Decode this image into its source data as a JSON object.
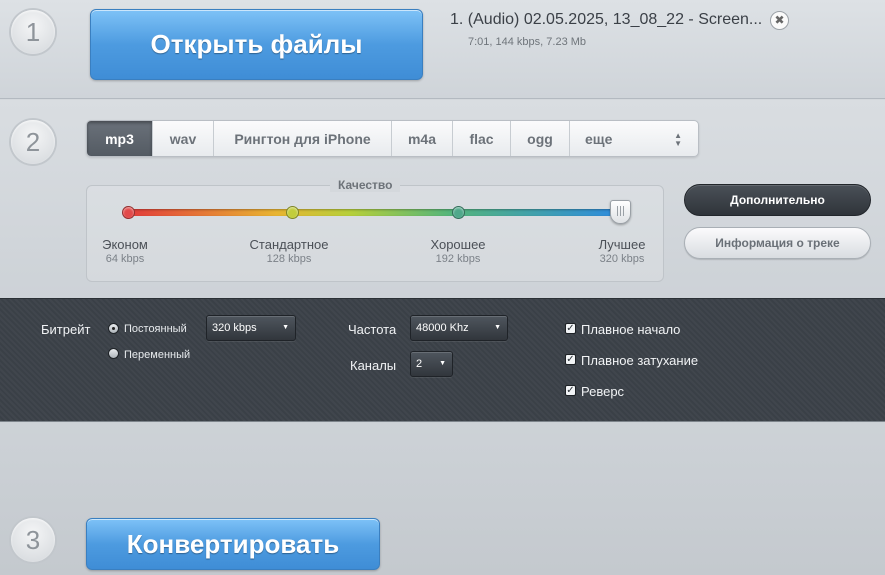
{
  "steps": [
    "1",
    "2",
    "3"
  ],
  "open_files_label": "Открыть файлы",
  "file": {
    "title": "1. (Audio) 02.05.2025, 13_08_22 - Screen...",
    "meta": "7:01, 144 kbps, 7.23 Mb",
    "close_glyph": "✖"
  },
  "formats": [
    "mp3",
    "wav",
    "Рингтон для iPhone",
    "m4a",
    "flac",
    "ogg"
  ],
  "format_more": "еще",
  "format_more_arrows": "▲▼",
  "quality": {
    "title": "Качество",
    "levels": [
      {
        "name": "Эконом",
        "rate": "64 kbps"
      },
      {
        "name": "Стандартное",
        "rate": "128 kbps"
      },
      {
        "name": "Хорошее",
        "rate": "192 kbps"
      },
      {
        "name": "Лучшее",
        "rate": "320 kbps"
      }
    ],
    "selected_index": 3,
    "dot_colors": [
      "#e24a4a",
      "#c2cd3b",
      "#4fa88a"
    ]
  },
  "advanced_button": "Дополнительно",
  "track_info_button": "Информация о треке",
  "advanced": {
    "bitrate_label": "Битрейт",
    "bitrate_modes": [
      {
        "label": "Постоянный",
        "checked": true
      },
      {
        "label": "Переменный",
        "checked": false
      }
    ],
    "bitrate_value": "320 kbps",
    "frequency_label": "Частота",
    "frequency_value": "48000 Khz",
    "channels_label": "Каналы",
    "channels_value": "2",
    "caret": "▼",
    "options": [
      {
        "label": "Плавное начало",
        "checked": true
      },
      {
        "label": "Плавное затухание",
        "checked": true
      },
      {
        "label": "Реверс",
        "checked": true
      }
    ],
    "check_glyph": "✓"
  },
  "convert_label": "Конвертировать",
  "colors": {
    "accent_blue": "#4d9be0",
    "panel_dark": "#3c4249"
  }
}
